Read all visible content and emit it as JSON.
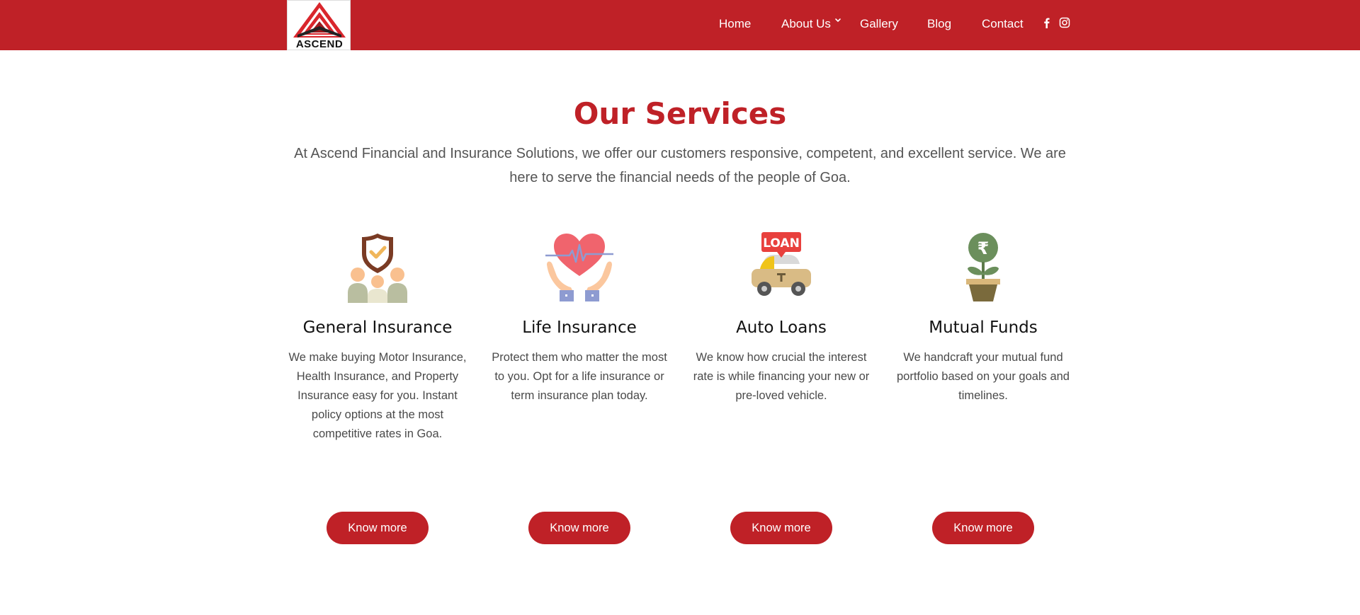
{
  "header": {
    "logo_text": "ASCEND",
    "nav": {
      "home": "Home",
      "about": "About Us",
      "gallery": "Gallery",
      "blog": "Blog",
      "contact": "Contact"
    },
    "social_icons": [
      "facebook-icon",
      "instagram-icon"
    ]
  },
  "services": {
    "title": "Our Services",
    "intro": "At Ascend Financial and Insurance Solutions, we offer our customers responsive, competent, and excellent service. We are here to serve the financial needs of the people of Goa.",
    "cards": [
      {
        "icon": "shield-family-icon",
        "title": "General Insurance",
        "description": "We make buying Motor Insurance, Health Insurance, and Property Insurance easy for you. Instant policy options at the most competitive rates in Goa.",
        "button": "Know more"
      },
      {
        "icon": "heart-hands-icon",
        "title": "Life Insurance",
        "description": "Protect them who matter the most to you. Opt for a life insurance or term insurance plan today.",
        "button": "Know more"
      },
      {
        "icon": "car-loan-icon",
        "title": "Auto Loans",
        "description": "We know how crucial the interest rate is while financing your new or pre-loved vehicle.",
        "button": "Know more"
      },
      {
        "icon": "money-plant-icon",
        "title": "Mutual Funds",
        "description": "We handcraft your mutual fund portfolio based on your goals and timelines.",
        "button": "Know more"
      }
    ],
    "loan_badge": "LOAN",
    "rupee_symbol": "₹"
  },
  "colors": {
    "brand_red": "#bf2127",
    "heading": "#111111",
    "body_text": "#4a4a4a",
    "background": "#ffffff"
  }
}
